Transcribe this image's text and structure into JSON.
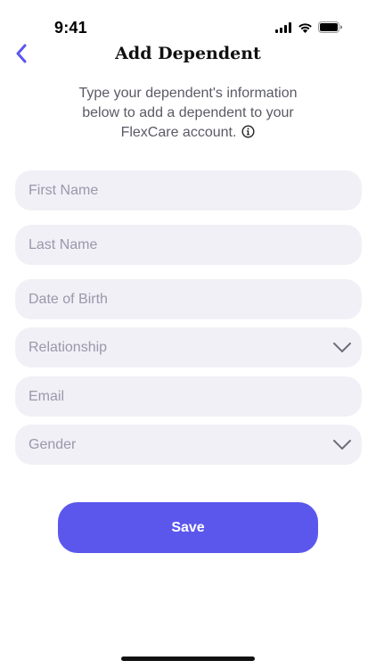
{
  "status_bar": {
    "time": "9:41"
  },
  "header": {
    "title": "Add Dependent",
    "back_icon": "chevron-left-icon"
  },
  "subtitle": {
    "line1": "Type your dependent's information",
    "line2": "below to add a dependent to your",
    "line3": "FlexCare account.",
    "info_icon": "info-circle-icon"
  },
  "form": {
    "first_name_placeholder": "First Name",
    "last_name_placeholder": "Last Name",
    "dob_placeholder": "Date of Birth",
    "relationship_placeholder": "Relationship",
    "email_placeholder": "Email",
    "gender_placeholder": "Gender"
  },
  "actions": {
    "save_label": "Save"
  },
  "colors": {
    "accent": "#5b57ec",
    "field_bg": "#f1f0f6",
    "placeholder": "#9a98aa",
    "back_icon": "#5b57ec"
  }
}
